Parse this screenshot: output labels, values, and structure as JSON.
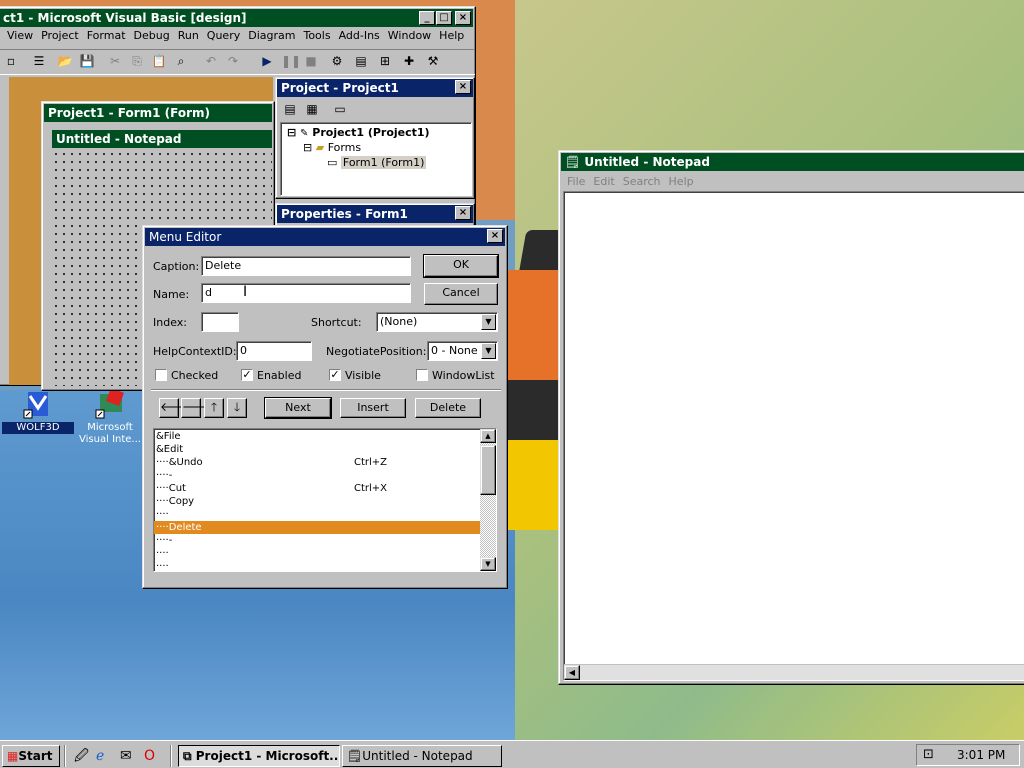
{
  "colors": {
    "title_active": "#0a246a",
    "title_green": "#004f22",
    "selection": "#e08a20"
  },
  "vb_main": {
    "title": "ct1 - Microsoft Visual Basic [design]",
    "menu": [
      "View",
      "Project",
      "Format",
      "Debug",
      "Run",
      "Query",
      "Diagram",
      "Tools",
      "Add-Ins",
      "Window",
      "Help"
    ]
  },
  "form_window": {
    "title": "Project1 - Form1 (Form)"
  },
  "form_inner": {
    "title": "Untitled - Notepad"
  },
  "project_explorer": {
    "title": "Project - Project1",
    "root": "Project1 (Project1)",
    "folder": "Forms",
    "form": "Form1 (Form1)"
  },
  "properties": {
    "title": "Properties - Form1"
  },
  "desktop_icons": [
    {
      "label": "WOLF3D"
    },
    {
      "label": "Microsoft Visual Inte..."
    }
  ],
  "menu_editor": {
    "title": "Menu Editor",
    "caption_label": "Caption:",
    "caption_value": "Delete",
    "name_label": "Name:",
    "name_value": "d",
    "index_label": "Index:",
    "index_value": "",
    "shortcut_label": "Shortcut:",
    "shortcut_value": "(None)",
    "helpcontext_label": "HelpContextID:",
    "helpcontext_value": "0",
    "negotiate_label": "NegotiatePosition:",
    "negotiate_value": "0 - None",
    "ok": "OK",
    "cancel": "Cancel",
    "checked_label": "Checked",
    "checked": false,
    "enabled_label": "Enabled",
    "enabled": true,
    "visible_label": "Visible",
    "visible": true,
    "windowlist_label": "WindowList",
    "windowlist": false,
    "next": "Next",
    "insert": "Insert",
    "delete": "Delete",
    "items": [
      {
        "text": "&File",
        "shortcut": "",
        "selected": false
      },
      {
        "text": "&Edit",
        "shortcut": "",
        "selected": false
      },
      {
        "text": "····&Undo",
        "shortcut": "Ctrl+Z",
        "selected": false
      },
      {
        "text": "····-",
        "shortcut": "",
        "selected": false
      },
      {
        "text": "····Cut",
        "shortcut": "Ctrl+X",
        "selected": false
      },
      {
        "text": "····Copy",
        "shortcut": "",
        "selected": false
      },
      {
        "text": "····",
        "shortcut": "",
        "selected": false
      },
      {
        "text": "····Delete",
        "shortcut": "",
        "selected": true
      },
      {
        "text": "····-",
        "shortcut": "",
        "selected": false
      },
      {
        "text": "····",
        "shortcut": "",
        "selected": false
      },
      {
        "text": "····",
        "shortcut": "",
        "selected": false
      }
    ]
  },
  "notepad": {
    "title": "Untitled - Notepad",
    "menu": [
      "File",
      "Edit",
      "Search",
      "Help"
    ]
  },
  "taskbar": {
    "start": "Start",
    "tasks": [
      {
        "label": "Project1 - Microsoft..."
      },
      {
        "label": "Untitled - Notepad"
      }
    ],
    "clock": "3:01 PM"
  }
}
